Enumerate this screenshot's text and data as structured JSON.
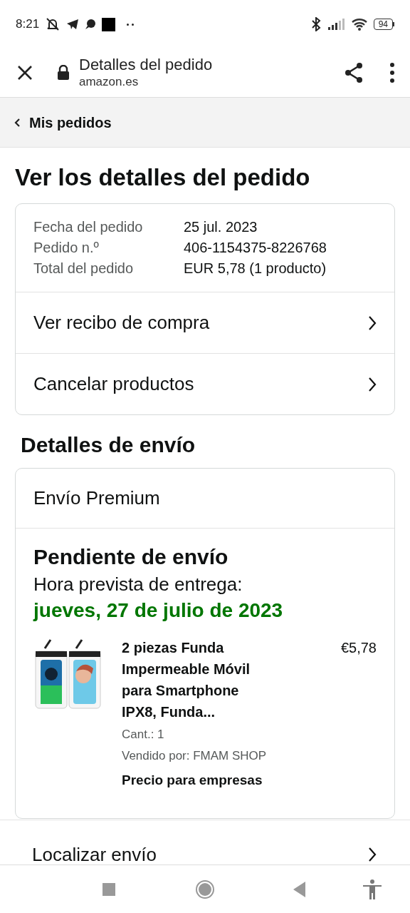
{
  "status_bar": {
    "time": "8:21",
    "battery": "94"
  },
  "browser": {
    "title": "Detalles del pedido",
    "url": "amazon.es"
  },
  "breadcrumb": {
    "label": "Mis pedidos"
  },
  "heading": "Ver los detalles del pedido",
  "summary": [
    {
      "label": "Fecha del pedido",
      "value": "25 jul. 2023"
    },
    {
      "label": "Pedido n.º",
      "value": "406-1154375-8226768"
    },
    {
      "label": "Total del pedido",
      "value": "EUR 5,78 (1 producto)"
    }
  ],
  "links": [
    "Ver recibo de compra",
    "Cancelar productos"
  ],
  "shipping_heading": "Detalles de envío",
  "shipping": {
    "method": "Envío Premium",
    "status": "Pendiente de envío",
    "eta_label": "Hora prevista de entrega:",
    "eta_date": "jueves, 27 de julio de 2023",
    "item": {
      "title": "2 piezas Funda Impermeable Móvil para Smartphone IPX8, Funda...",
      "price": "€5,78",
      "quantity": "Cant.: 1",
      "seller": "Vendido por: FMAM SHOP",
      "note": "Precio para empresas"
    }
  },
  "track_link": "Localizar envío"
}
